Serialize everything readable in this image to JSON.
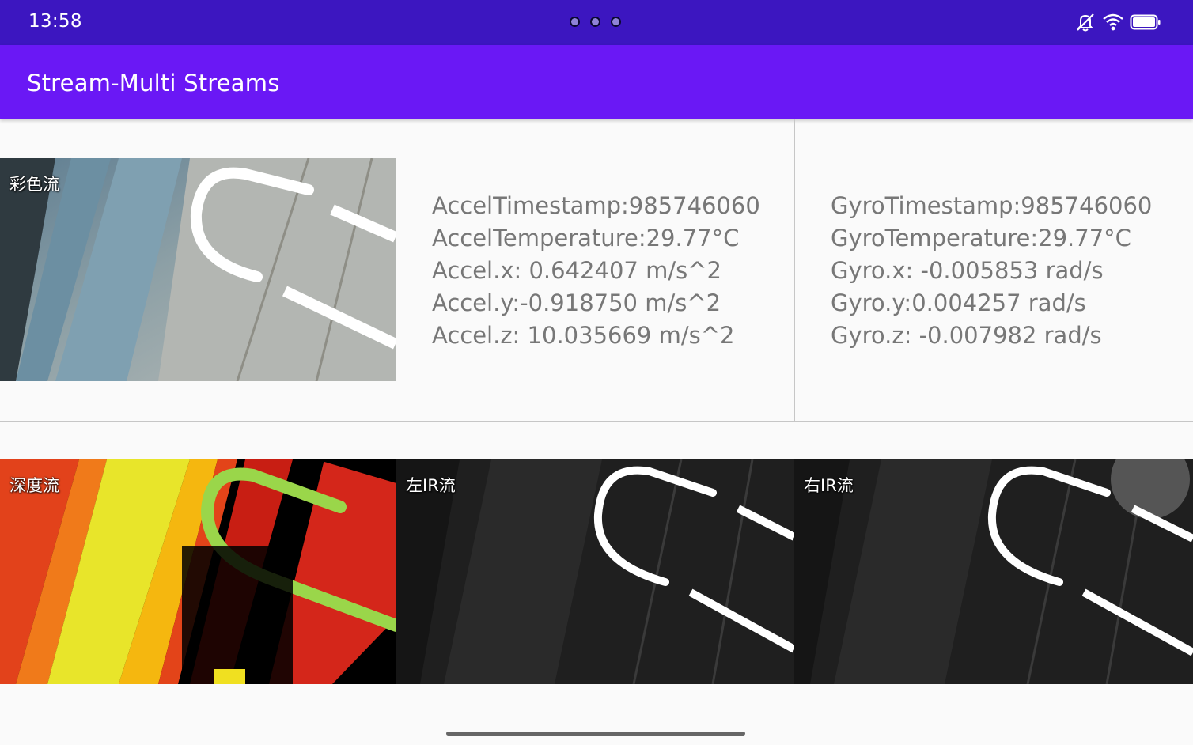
{
  "status_bar": {
    "time": "13:58",
    "icons": [
      "mute-icon",
      "wifi-icon",
      "battery-icon"
    ]
  },
  "app_bar": {
    "title": "Stream-Multi Streams"
  },
  "streams": {
    "color": {
      "label": "彩色流"
    },
    "depth": {
      "label": "深度流"
    },
    "left_ir": {
      "label": "左IR流"
    },
    "right_ir": {
      "label": "右IR流"
    }
  },
  "accel": {
    "timestamp": "AccelTimestamp:985746060",
    "temperature": "AccelTemperature:29.77°C",
    "x": "Accel.x: 0.642407 m/s^2",
    "y": "Accel.y:-0.918750 m/s^2",
    "z": "Accel.z: 10.035669 m/s^2"
  },
  "gyro": {
    "timestamp": "GyroTimestamp:985746060",
    "temperature": "GyroTemperature:29.77°C",
    "x": "Gyro.x: -0.005853 rad/s",
    "y": "Gyro.y:0.004257 rad/s",
    "z": "Gyro.z: -0.007982 rad/s"
  },
  "colors": {
    "status_bar": "#3c16c0",
    "app_bar": "#6a18f5",
    "sensor_text": "#777777"
  }
}
